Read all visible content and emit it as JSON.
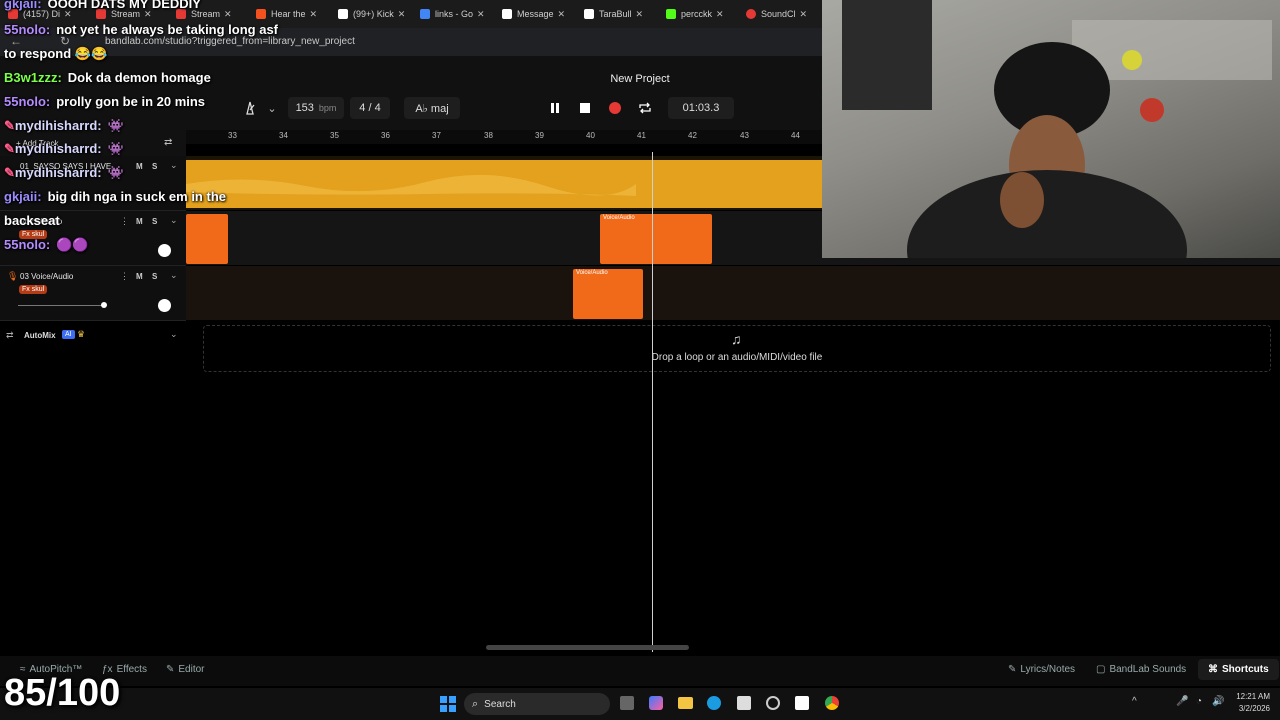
{
  "browser": {
    "tabs": [
      {
        "label": "(4157) Di",
        "color": "#e53935"
      },
      {
        "label": "Stream",
        "color": "#e53935"
      },
      {
        "label": "Stream",
        "color": "#e53935"
      },
      {
        "label": "Hear the",
        "color": "#f4511e"
      },
      {
        "label": "(99+) Kick",
        "color": "#ffffff"
      },
      {
        "label": "links - Go",
        "color": "#4285f4"
      },
      {
        "label": "Message",
        "color": "#ffffff"
      },
      {
        "label": "TaraBull",
        "color": "#ffffff"
      },
      {
        "label": "percckk",
        "color": "#53fc18"
      },
      {
        "label": "SoundCl",
        "color": "#e53935"
      }
    ],
    "url": "bandlab.com/studio?triggered_from=library_new_project"
  },
  "studio": {
    "project_title": "New Project",
    "tempo_value": "153",
    "tempo_unit": "bpm",
    "time_signature": "4 / 4",
    "key": "A♭ maj",
    "time": "01:03.3",
    "ruler_ticks": [
      "33",
      "34",
      "35",
      "36",
      "37",
      "38",
      "39",
      "40",
      "41",
      "42",
      "43",
      "44"
    ],
    "add_track": "Add Track",
    "tracks": [
      {
        "name": "01_SAYSO SAYS I HAVE..."
      },
      {
        "name": "Voice/Audio",
        "fx": "Fx skul"
      },
      {
        "name": "03 Voice/Audio",
        "fx": "Fx skul"
      }
    ],
    "mute": "M",
    "solo": "S",
    "clip_label": "Voice/Audio",
    "automix": "AutoMix",
    "ai_badge": "AI",
    "drop_text": "Drop a loop or an audio/MIDI/video file",
    "bottom_left": {
      "autopitch": "AutoPitch™",
      "effects": "Effects",
      "editor": "Editor"
    },
    "bottom_right": {
      "lyrics": "Lyrics/Notes",
      "sounds": "BandLab Sounds",
      "shortcuts": "Shortcuts"
    }
  },
  "chat": [
    {
      "user": "gkjaii:",
      "color": "#9b8cff",
      "msg": "OOOH DATS MY DEDDIY"
    },
    {
      "user": "55nolo:",
      "color": "#b58cff",
      "msg": "not yet he always be taking long asf"
    },
    {
      "user": "",
      "color": "#ffffff",
      "msg": "to respond 😂😂"
    },
    {
      "user": "B3w1zzz:",
      "color": "#7cff4a",
      "msg": "Dok da demon homage"
    },
    {
      "user": "55nolo:",
      "color": "#b58cff",
      "msg": "prolly gon be in 20 mins"
    },
    {
      "user": "mydihisharrd:",
      "color": "#d8d8ff",
      "msg": ""
    },
    {
      "user": "mydihisharrd:",
      "color": "#d8d8ff",
      "msg": ""
    },
    {
      "user": "mydihisharrd:",
      "color": "#d8d8ff",
      "msg": ""
    },
    {
      "user": "gkjaii:",
      "color": "#9b8cff",
      "msg": "big dih nga in suck em in the"
    },
    {
      "user": "",
      "color": "#ffffff",
      "msg": "backseat"
    },
    {
      "user": "55nolo:",
      "color": "#b58cff",
      "msg": ""
    }
  ],
  "score": "85/100",
  "taskbar": {
    "search": "Search",
    "time": "12:21 AM",
    "date": "3/2/2026"
  },
  "colors": {
    "accent_orange": "#f06a1a",
    "waveform_yellow": "#f0ad1f",
    "record_red": "#e53935"
  }
}
